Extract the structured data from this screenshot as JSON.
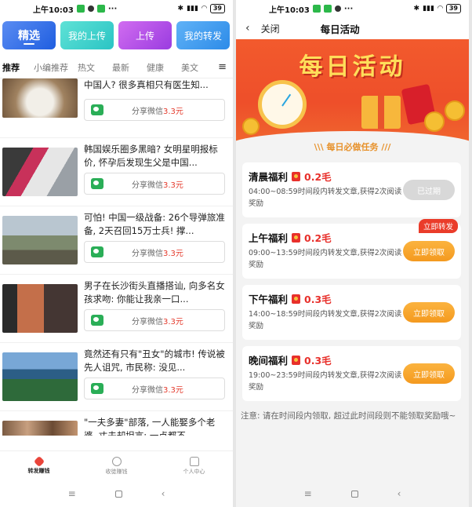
{
  "left": {
    "status": {
      "time": "上午10:03",
      "battery": "39"
    },
    "top_buttons": [
      "精选",
      "我的上传",
      "上传",
      "我的转发"
    ],
    "tabs": [
      "推荐",
      "小编推荐",
      "热文",
      "最新",
      "健康",
      "美文"
    ],
    "share_label": "分享微信",
    "articles": [
      {
        "title": "中国人? 很多真相只有医生知...",
        "price": "3.3元"
      },
      {
        "title": "韩国娱乐圈多黑暗? 女明星明报标价, 怀孕后发现生父是中国...",
        "price": "3.3元"
      },
      {
        "title": "可怕! 中国一级战备: 26个导弹旅准备, 2天召回15万士兵! 撑...",
        "price": "3.3元"
      },
      {
        "title": "男子在长沙街头直播搭讪, 向多名女孩求吻: 你能让我亲一口...",
        "price": "3.3元"
      },
      {
        "title": "竟然还有只有\"丑女\"的城市! 传说被先人诅咒, 市民称: 没见...",
        "price": "3.3元"
      },
      {
        "title": "\"一夫多妻\"部落, 一人能娶多个老婆, 丈夫却坦言: 一点都不...",
        "price": ""
      }
    ],
    "bottom_nav": [
      {
        "label": "转发赚钱",
        "icon": "forward-money-icon",
        "active": true
      },
      {
        "label": "收徒赚钱",
        "icon": "person-icon",
        "active": false
      },
      {
        "label": "个人中心",
        "icon": "home-icon",
        "active": false
      }
    ]
  },
  "right": {
    "status": {
      "time": "上午10:03",
      "battery": "39"
    },
    "header": {
      "close": "关闭",
      "title": "每日活动"
    },
    "banner_title": "每日活动",
    "task_header": "每日必做任务",
    "tasks": [
      {
        "name": "清晨福利",
        "reward": "0.2毛",
        "desc": "04:00~08:59时间段内转发文章,获得2次阅读奖励",
        "action": "已过期",
        "expired": true,
        "badge": ""
      },
      {
        "name": "上午福利",
        "reward": "0.2毛",
        "desc": "09:00~13:59时间段内转发文章,获得2次阅读奖励",
        "action": "立即领取",
        "expired": false,
        "badge": "立即转发"
      },
      {
        "name": "下午福利",
        "reward": "0.3毛",
        "desc": "14:00~18:59时间段内转发文章,获得2次阅读奖励",
        "action": "立即领取",
        "expired": false,
        "badge": ""
      },
      {
        "name": "晚间福利",
        "reward": "0.3毛",
        "desc": "19:00~23:59时间段内转发文章,获得2次阅读奖励",
        "action": "立即领取",
        "expired": false,
        "badge": ""
      }
    ],
    "notice": "注意: 请在时间段内领取, 超过此时间段则不能领取奖励哦~"
  },
  "colors": {
    "accent_red": "#e8302b",
    "accent_orange": "#f49a1f",
    "price_red": "#e43a2c",
    "wechat_green": "#2aae57"
  }
}
